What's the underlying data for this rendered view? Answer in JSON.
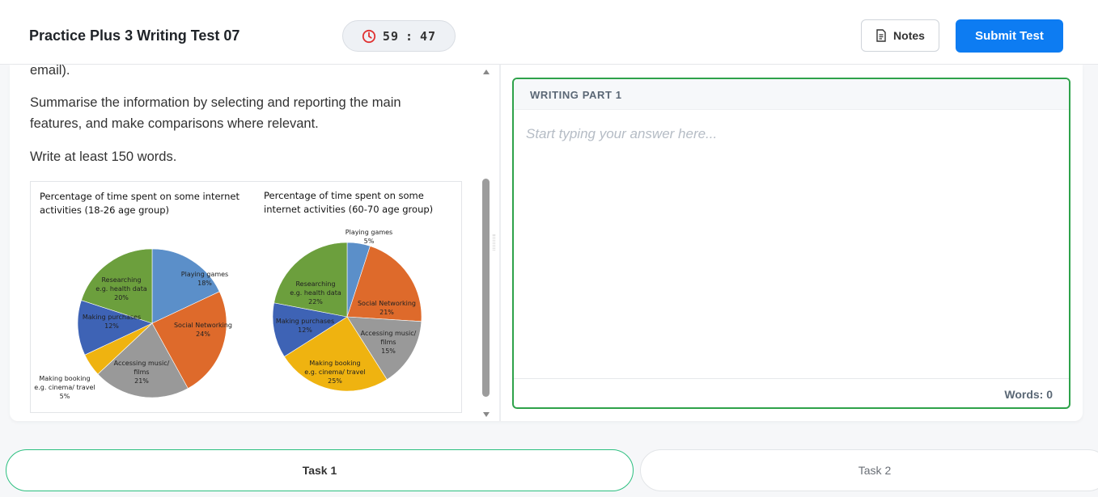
{
  "header": {
    "title": "Practice Plus 3 Writing Test 07",
    "timer": {
      "minutes": "59",
      "separator": ":",
      "seconds": "47",
      "icon": "clock-icon",
      "icon_color": "#e03131"
    },
    "notes_label": "Notes",
    "notes_icon": "document-icon",
    "submit_label": "Submit Test",
    "accent_color": "#0d7cf2"
  },
  "prompt": {
    "line_cut": "email).",
    "instruction": "Summarise the information by selecting and reporting the main features, and make comparisons where relevant.",
    "word_requirement": "Write at least 150 words."
  },
  "chart_data": [
    {
      "type": "pie",
      "title": "Percentage of time spent on some internet activities (18-26 age group)",
      "slices": [
        {
          "label": "Playing games",
          "value": 18,
          "color": "#5b8fc9"
        },
        {
          "label": "Social Networking",
          "value": 24,
          "color": "#de6a2b"
        },
        {
          "label": "Accessing music/ films",
          "value": 21,
          "color": "#999999"
        },
        {
          "label": "Making booking e.g. cinema/ travel",
          "value": 5,
          "color": "#efb310"
        },
        {
          "label": "Making purchases",
          "value": 12,
          "color": "#3e63b5"
        },
        {
          "label": "Researching e.g. health data",
          "value": 20,
          "color": "#6c9f3d"
        }
      ]
    },
    {
      "type": "pie",
      "title": "Percentage of time spent on some internet activities (60-70 age group)",
      "slices": [
        {
          "label": "Playing games",
          "value": 5,
          "color": "#5b8fc9"
        },
        {
          "label": "Social Networking",
          "value": 21,
          "color": "#de6a2b"
        },
        {
          "label": "Accessing music/ films",
          "value": 15,
          "color": "#999999"
        },
        {
          "label": "Making booking e.g. cinema/ travel",
          "value": 25,
          "color": "#efb310"
        },
        {
          "label": "Making purchases",
          "value": 12,
          "color": "#3e63b5"
        },
        {
          "label": "Researching e.g. health data",
          "value": 22,
          "color": "#6c9f3d"
        }
      ]
    }
  ],
  "writing": {
    "part_label": "WRITING PART 1",
    "placeholder": "Start typing your answer here...",
    "word_count": "Words: 0",
    "border_color": "#2ea24a"
  },
  "tabs": [
    {
      "label": "Task 1",
      "active": true
    },
    {
      "label": "Task 2",
      "active": false
    }
  ]
}
